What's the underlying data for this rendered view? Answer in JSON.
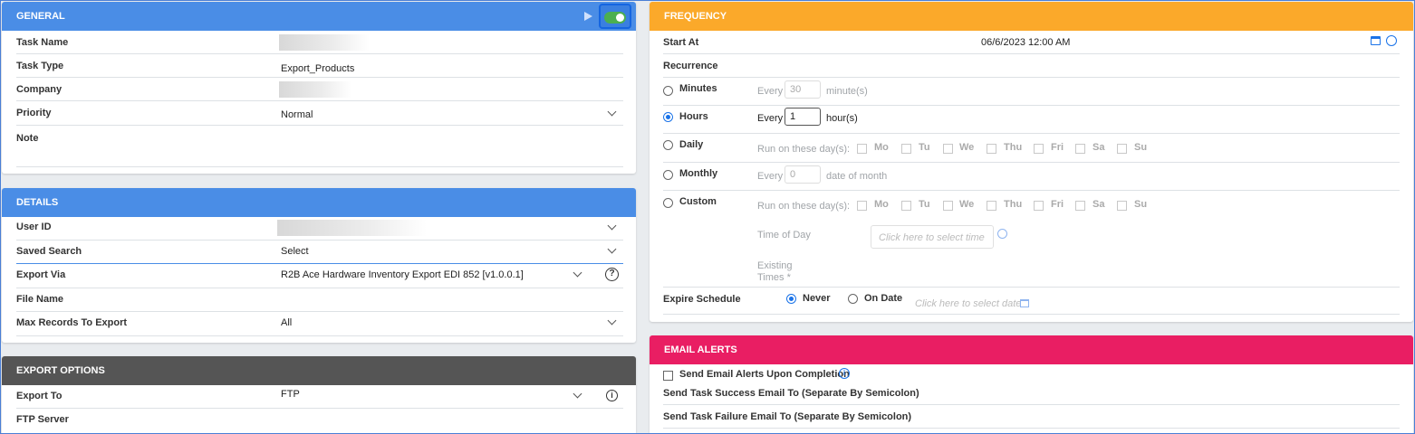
{
  "general": {
    "title": "GENERAL",
    "task_name_label": "Task Name",
    "task_type_label": "Task Type",
    "task_type_value": "Export_Products",
    "company_label": "Company",
    "priority_label": "Priority",
    "priority_value": "Normal",
    "note_label": "Note"
  },
  "details": {
    "title": "DETAILS",
    "user_id_label": "User ID",
    "saved_search_label": "Saved Search",
    "saved_search_value": "Select",
    "export_via_label": "Export Via",
    "export_via_value": "R2B Ace Hardware Inventory Export EDI 852 [v1.0.0.1]",
    "file_name_label": "File Name",
    "max_records_label": "Max Records To Export",
    "max_records_value": "All"
  },
  "export_options": {
    "title": "EXPORT OPTIONS",
    "export_to_label": "Export To",
    "export_to_value": "FTP",
    "ftp_server_label": "FTP Server"
  },
  "frequency": {
    "title": "FREQUENCY",
    "start_at_label": "Start At",
    "start_at_value": "06/6/2023 12:00 AM",
    "recurrence_label": "Recurrence",
    "minutes_label": "Minutes",
    "minutes_every": "Every",
    "minutes_value": "30",
    "minutes_unit": "minute(s)",
    "hours_label": "Hours",
    "hours_every": "Every",
    "hours_value": "1",
    "hours_unit": "hour(s)",
    "daily_label": "Daily",
    "daily_run": "Run on these day(s):",
    "monthly_label": "Monthly",
    "monthly_every": "Every",
    "monthly_value": "0",
    "monthly_unit": "date of month",
    "custom_label": "Custom",
    "custom_run": "Run on these day(s):",
    "days": [
      "Mo",
      "Tu",
      "We",
      "Thu",
      "Fri",
      "Sa",
      "Su"
    ],
    "time_of_day_label": "Time of Day",
    "time_placeholder": "Click here to select time",
    "existing_times_label": "Existing Times *",
    "expire_label": "Expire Schedule",
    "never_label": "Never",
    "on_date_label": "On Date",
    "date_placeholder": "Click here to select date"
  },
  "email_alerts": {
    "title": "EMAIL ALERTS",
    "send_alerts_label": "Send Email Alerts Upon Completion",
    "success_label": "Send Task Success Email To (Separate By Semicolon)",
    "failure_label": "Send Task Failure Email To (Separate By Semicolon)"
  },
  "colors": {
    "general_header": "#4a8de6",
    "frequency_header": "#fba92a",
    "email_header": "#e91e63",
    "export_options_header": "#555555",
    "toggle_on": "#4caf50",
    "radio_selected": "#1a73e8"
  }
}
